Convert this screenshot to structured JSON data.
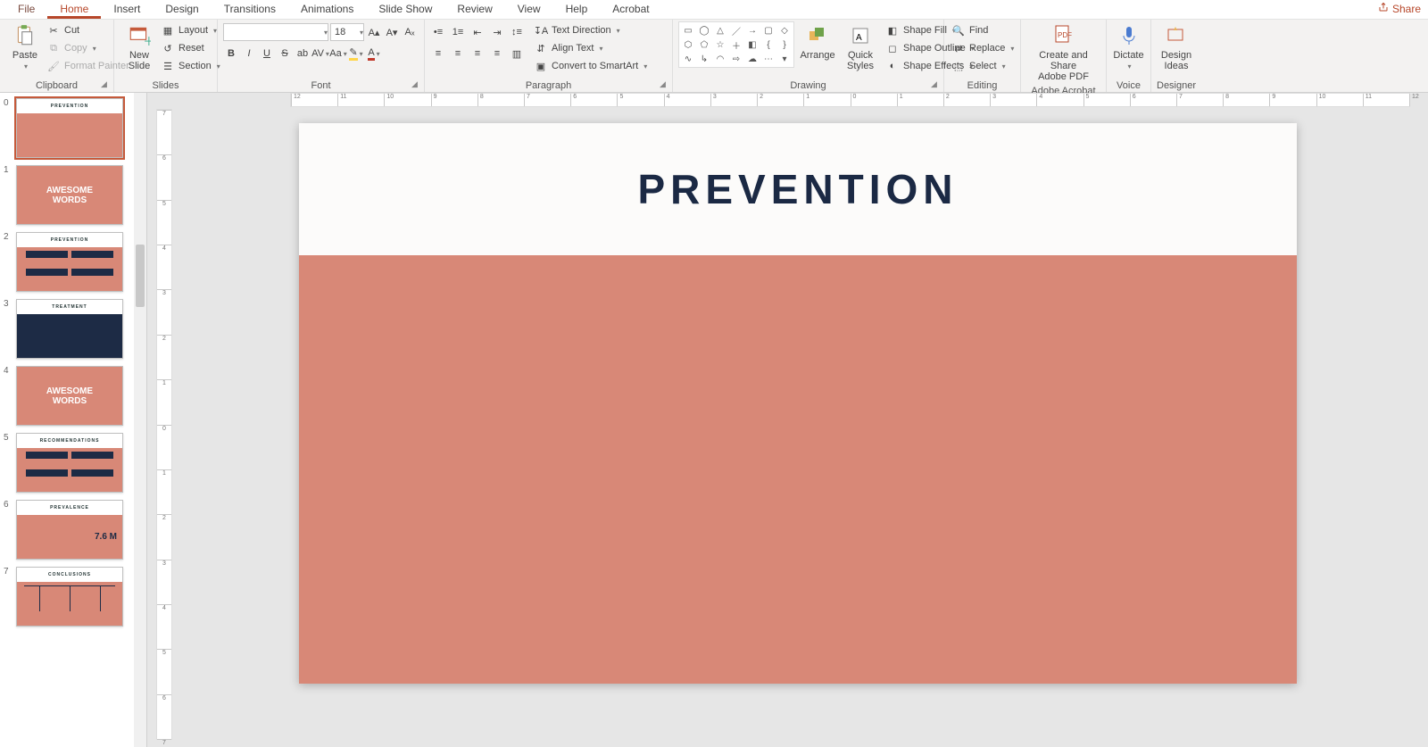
{
  "menu": {
    "tabs": [
      "File",
      "Home",
      "Insert",
      "Design",
      "Transitions",
      "Animations",
      "Slide Show",
      "Review",
      "View",
      "Help",
      "Acrobat"
    ],
    "active": "Home",
    "share": "Share"
  },
  "ribbon": {
    "clipboard": {
      "paste": "Paste",
      "cut": "Cut",
      "copy": "Copy",
      "painter": "Format Painter",
      "label": "Clipboard"
    },
    "slides": {
      "newslide": "New\nSlide",
      "layout": "Layout",
      "reset": "Reset",
      "section": "Section",
      "label": "Slides"
    },
    "font": {
      "name": "",
      "size": "18",
      "label": "Font"
    },
    "paragraph": {
      "textdir": "Text Direction",
      "align": "Align Text",
      "smartart": "Convert to SmartArt",
      "label": "Paragraph"
    },
    "drawing": {
      "arrange": "Arrange",
      "quick": "Quick\nStyles",
      "fill": "Shape Fill",
      "outline": "Shape Outline",
      "effects": "Shape Effects",
      "label": "Drawing"
    },
    "editing": {
      "find": "Find",
      "replace": "Replace",
      "select": "Select",
      "label": "Editing"
    },
    "acrobat": {
      "btn": "Create and Share\nAdobe PDF",
      "label": "Adobe Acrobat"
    },
    "voice": {
      "btn": "Dictate",
      "label": "Voice"
    },
    "designer": {
      "btn": "Design\nIdeas",
      "label": "Designer"
    }
  },
  "slide": {
    "title": "PREVENTION"
  },
  "thumbs": [
    {
      "n": "0",
      "title": "PREVENTION",
      "kind": "title"
    },
    {
      "n": "1",
      "title": "AWESOME\nWORDS",
      "kind": "big"
    },
    {
      "n": "2",
      "title": "PREVENTION",
      "kind": "flow"
    },
    {
      "n": "3",
      "title": "TREATMENT",
      "kind": "dark"
    },
    {
      "n": "4",
      "title": "AWESOME\nWORDS",
      "kind": "big"
    },
    {
      "n": "5",
      "title": "RECOMMENDATIONS",
      "kind": "flow"
    },
    {
      "n": "6",
      "title": "PREVALENCE",
      "kind": "map",
      "stat": "7.6 M"
    },
    {
      "n": "7",
      "title": "CONCLUSIONS",
      "kind": "org"
    }
  ],
  "hruler": [
    "12",
    "11",
    "10",
    "9",
    "8",
    "7",
    "6",
    "5",
    "4",
    "3",
    "2",
    "1",
    "0",
    "1",
    "2",
    "3",
    "4",
    "5",
    "6",
    "7",
    "8",
    "9",
    "10",
    "11",
    "12"
  ],
  "vruler": [
    "7",
    "6",
    "5",
    "4",
    "3",
    "2",
    "1",
    "0",
    "1",
    "2",
    "3",
    "4",
    "5",
    "6",
    "7"
  ]
}
